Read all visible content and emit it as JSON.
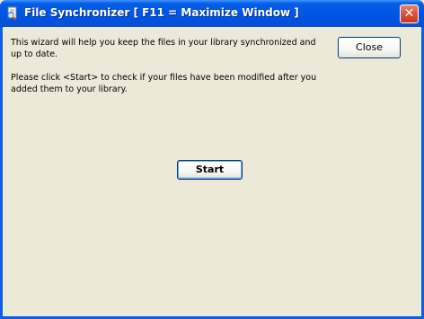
{
  "window": {
    "title": "File Synchronizer [ F11 = Maximize Window ]",
    "app_icon": "file-sync-app-icon",
    "close_glyph": "✕"
  },
  "content": {
    "intro_text": "This wizard will help you keep the files in your library synchronized and up to date.",
    "instruction_text": "Please click <Start> to check if your files have been modified after you added them to your library."
  },
  "buttons": {
    "close_label": "Close",
    "start_label": "Start"
  },
  "colors": {
    "titlebar": "#0054e3",
    "client_background": "#ece9d8",
    "close_x_background": "#d9533a"
  }
}
